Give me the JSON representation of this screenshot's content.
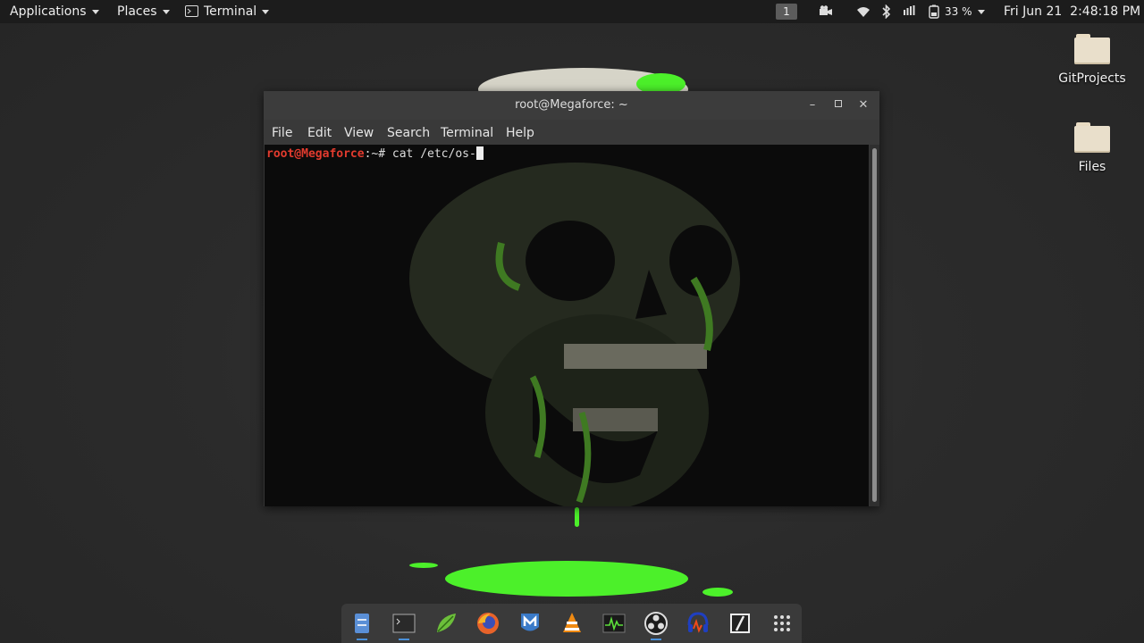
{
  "topbar": {
    "applications": "Applications",
    "places": "Places",
    "terminal": "Terminal",
    "workspace": "1",
    "battery": "33 %",
    "clock": "Fri Jun 21  2:48:18 PM",
    "icons": [
      "terminal-icon",
      "video-camera-icon",
      "wifi-icon",
      "bluetooth-icon",
      "volume-icon",
      "battery-icon"
    ]
  },
  "desktop": {
    "icons": [
      {
        "label": "GitProjects",
        "icon": "folder-icon"
      },
      {
        "label": "Files",
        "icon": "folder-icon"
      }
    ],
    "accent": "#4cf02a"
  },
  "window": {
    "title": "root@Megaforce: ~",
    "menu": [
      "File",
      "Edit",
      "View",
      "Search",
      "Terminal",
      "Help"
    ],
    "controls": [
      "minimize-icon",
      "maximize-icon",
      "close-icon"
    ],
    "terminal": {
      "user": "root@Megaforce",
      "path": ":~",
      "symbol": "#",
      "command": "cat /etc/os-"
    },
    "prompt_color": "#e23b2e"
  },
  "dock": {
    "apps": [
      "file-manager-icon",
      "terminal-icon",
      "gedit-icon",
      "firefox-icon",
      "metasploit-icon",
      "vlc-icon",
      "system-monitor-icon",
      "obs-icon",
      "audacity-icon",
      "terminal-writer-icon",
      "app-grid-icon"
    ]
  }
}
